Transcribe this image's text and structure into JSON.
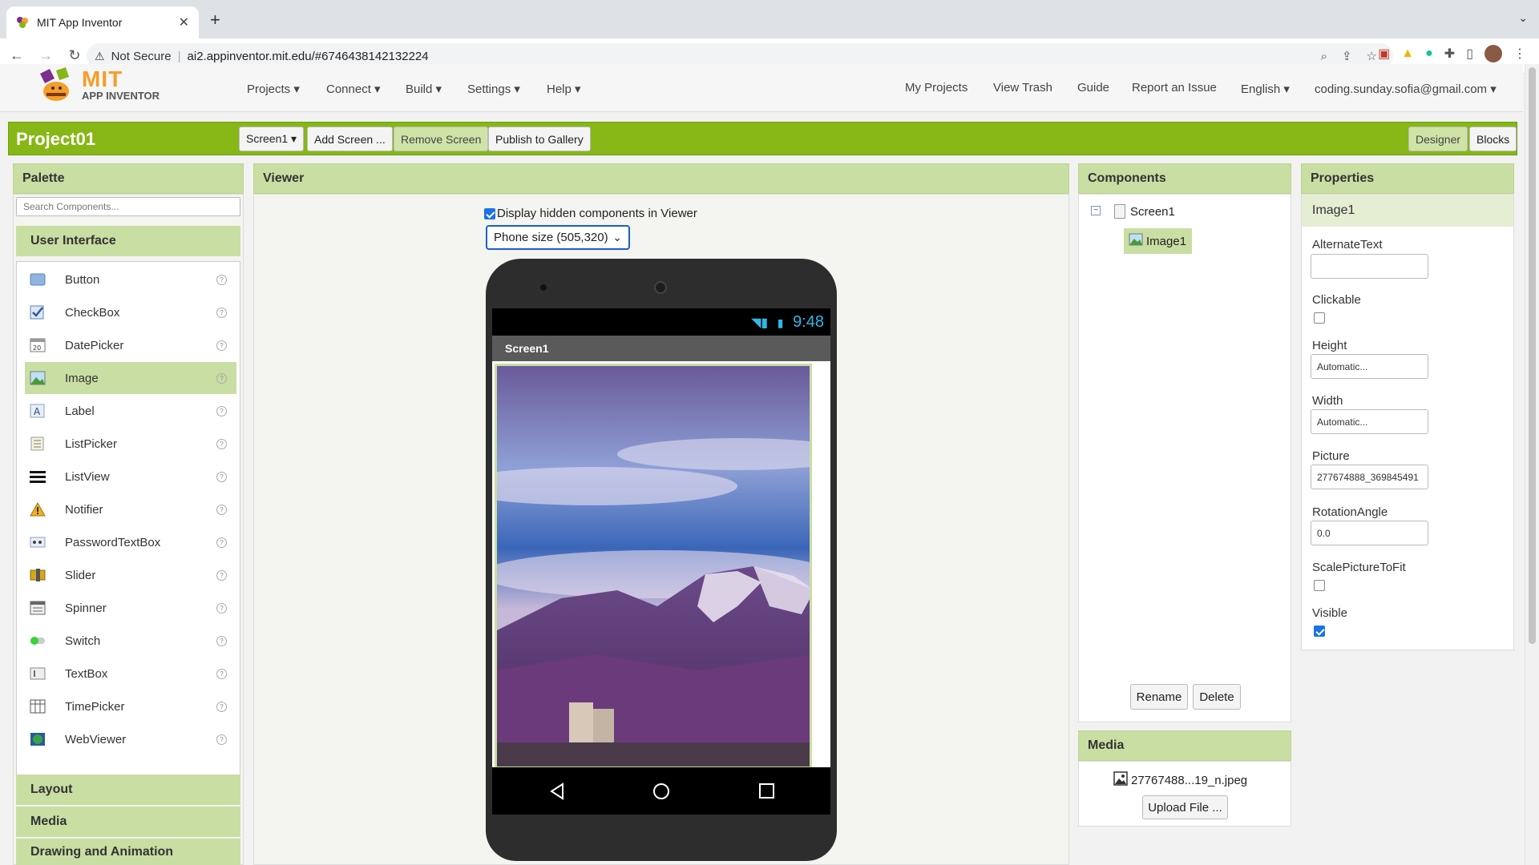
{
  "browser": {
    "tab_title": "MIT App Inventor",
    "new_tab": "+",
    "security_label": "Not Secure",
    "url": "ai2.appinventor.mit.edu/#6746438142132224"
  },
  "header": {
    "logo_line1": "MIT",
    "logo_line2": "APP INVENTOR",
    "menus": [
      "Projects ▾",
      "Connect ▾",
      "Build ▾",
      "Settings ▾",
      "Help ▾"
    ],
    "right_links": [
      "My Projects",
      "View Trash",
      "Guide",
      "Report an Issue",
      "English ▾",
      "coding.sunday.sofia@gmail.com ▾"
    ]
  },
  "projectbar": {
    "name": "Project01",
    "screen_select": "Screen1 ▾",
    "add_screen": "Add Screen ...",
    "remove_screen": "Remove Screen",
    "publish": "Publish to Gallery",
    "designer": "Designer",
    "blocks": "Blocks"
  },
  "palette": {
    "title": "Palette",
    "search_placeholder": "Search Components...",
    "category": "User Interface",
    "items": [
      "Button",
      "CheckBox",
      "DatePicker",
      "Image",
      "Label",
      "ListPicker",
      "ListView",
      "Notifier",
      "PasswordTextBox",
      "Slider",
      "Spinner",
      "Switch",
      "TextBox",
      "TimePicker",
      "WebViewer"
    ],
    "selected_item": "Image",
    "other_categories": [
      "Layout",
      "Media",
      "Drawing and Animation"
    ]
  },
  "viewer": {
    "title": "Viewer",
    "display_hidden": "Display hidden components in Viewer",
    "display_hidden_checked": true,
    "size_select": "Phone size (505,320)",
    "time": "9:48",
    "screen_title": "Screen1"
  },
  "components": {
    "title": "Components",
    "tree": [
      "Screen1",
      "Image1"
    ],
    "rename": "Rename",
    "delete": "Delete"
  },
  "media": {
    "title": "Media",
    "file": "27767488...19_n.jpeg",
    "upload": "Upload File ..."
  },
  "properties": {
    "title": "Properties",
    "component": "Image1",
    "alternate_text_label": "AlternateText",
    "alternate_text_value": "",
    "clickable_label": "Clickable",
    "clickable_checked": false,
    "height_label": "Height",
    "height_value": "Automatic...",
    "width_label": "Width",
    "width_value": "Automatic...",
    "picture_label": "Picture",
    "picture_value": "277674888_369845491",
    "rotation_label": "RotationAngle",
    "rotation_value": "0.0",
    "scale_label": "ScalePictureToFit",
    "scale_checked": false,
    "visible_label": "Visible",
    "visible_checked": true
  },
  "colors": {
    "accent_green": "#86b716",
    "panel_header": "#c9dea3",
    "selection_blue": "#1a73e8"
  }
}
